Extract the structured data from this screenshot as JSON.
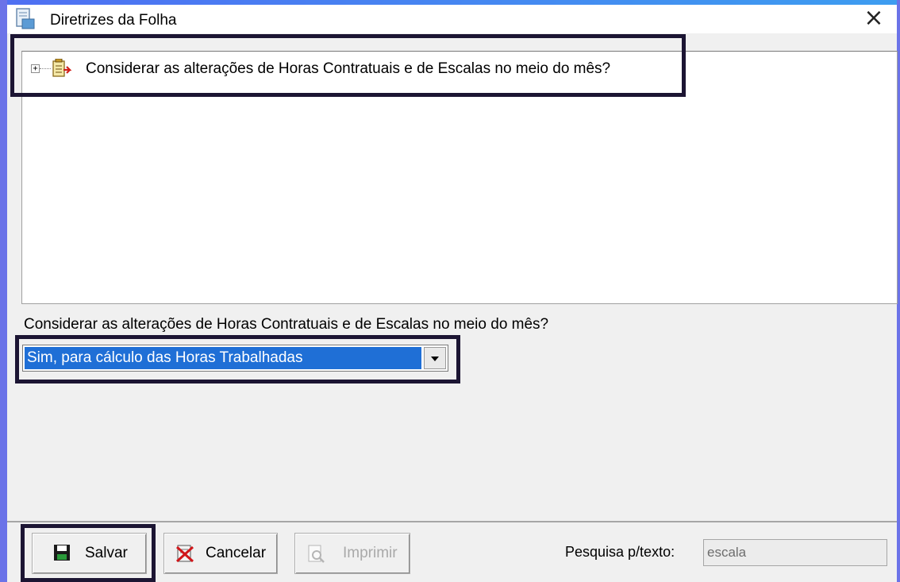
{
  "window": {
    "title": "Diretrizes da Folha",
    "title_icon": "document-icon",
    "close_icon": "close-icon"
  },
  "tree": {
    "items": [
      {
        "label": "Considerar as alterações de Horas Contratuais e de Escalas no meio do mês?",
        "icon": "checklist-icon",
        "expanded": false
      }
    ]
  },
  "detail": {
    "question_label": "Considerar as alterações de Horas Contratuais e de Escalas no meio do mês?",
    "selected_option": "Sim, para cálculo das Horas Trabalhadas"
  },
  "toolbar": {
    "save_label": "Salvar",
    "cancel_label": "Cancelar",
    "print_label": "Imprimir",
    "search_label": "Pesquisa p/texto:",
    "search_value": "escala"
  },
  "colors": {
    "selection": "#1f6fd6",
    "frame": "#6b73e8",
    "highlight_border": "#1c1533"
  }
}
